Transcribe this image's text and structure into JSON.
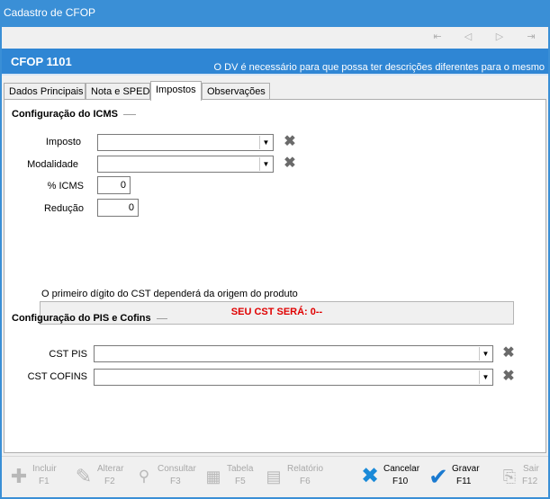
{
  "window": {
    "title": "Cadastro de CFOP"
  },
  "nav": {
    "first": "⇤",
    "prev": "◁",
    "next": "▷",
    "last": "⇥"
  },
  "header": {
    "title": "CFOP  1101",
    "note": "O DV é necessário para que possa ter descrições diferentes para o mesmo"
  },
  "tabs": [
    {
      "label": "Dados Principais"
    },
    {
      "label": "Nota e SPED"
    },
    {
      "label": "Impostos"
    },
    {
      "label": "Observações"
    }
  ],
  "icms": {
    "section_title": "Configuração do ICMS",
    "imposto_label": "Imposto",
    "imposto_value": "",
    "modalidade_label": "Modalidade",
    "modalidade_value": "",
    "percent_label": "% ICMS",
    "percent_value": "0",
    "reducao_label": "Redução",
    "reducao_value": "0",
    "cst_info": "O primeiro dígito do CST dependerá da origem do produto",
    "cst_result": "SEU CST SERÁ: 0--"
  },
  "pis": {
    "section_title": "Configuração do PIS e Cofins",
    "cst_pis_label": "CST PIS",
    "cst_pis_value": "",
    "cst_cofins_label": "CST COFINS",
    "cst_cofins_value": ""
  },
  "toolbar": {
    "incluir": {
      "label": "Incluir",
      "key": "F1"
    },
    "alterar": {
      "label": "Alterar",
      "key": "F2"
    },
    "consultar": {
      "label": "Consultar",
      "key": "F3"
    },
    "tabela": {
      "label": "Tabela",
      "key": "F5"
    },
    "relatorio": {
      "label": "Relatório",
      "key": "F6"
    },
    "cancelar": {
      "label": "Cancelar",
      "key": "F10"
    },
    "gravar": {
      "label": "Gravar",
      "key": "F11"
    },
    "sair": {
      "label": "Sair",
      "key": "F12"
    }
  },
  "colors": {
    "accent": "#2f86d4",
    "cst_result": "#e00000",
    "cancel_icon": "#1a8ad8",
    "save_icon": "#1a7ad0"
  }
}
